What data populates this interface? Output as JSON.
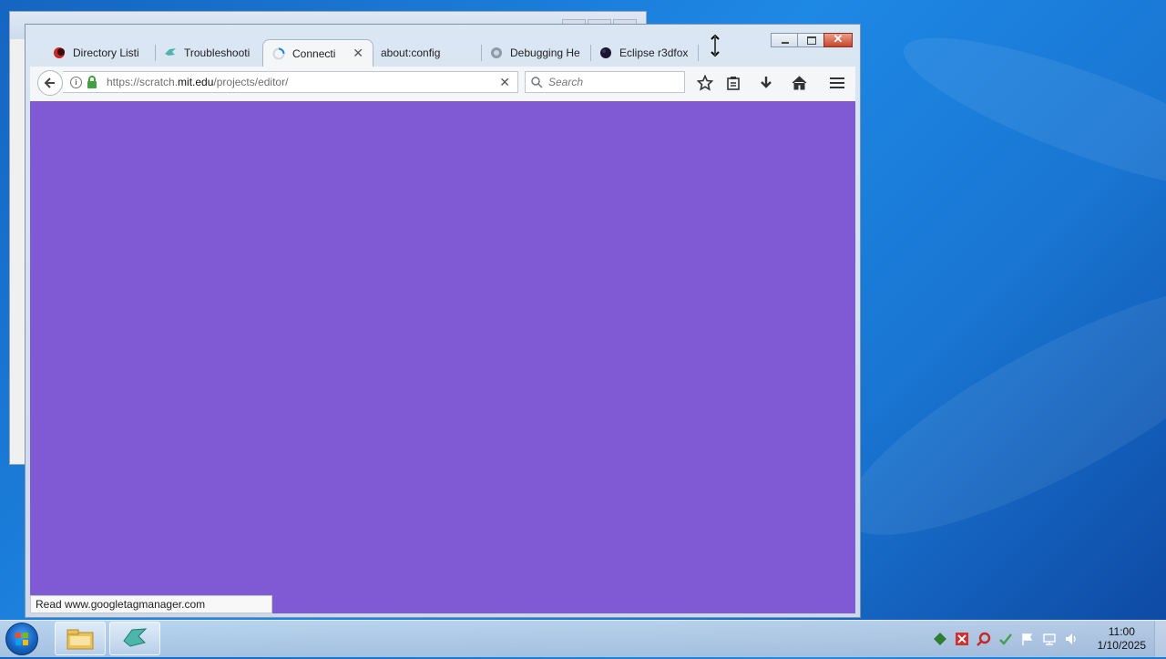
{
  "browser": {
    "tabs": [
      {
        "label": "Directory Listi",
        "icon": "eclipse-red-icon",
        "active": false
      },
      {
        "label": "Troubleshooti",
        "icon": "bird-icon",
        "active": false
      },
      {
        "label": "Connecti",
        "icon": "loading-spinner-icon",
        "active": true
      },
      {
        "label": "about:config",
        "icon": "",
        "active": false
      },
      {
        "label": "Debugging He",
        "icon": "puzzle-icon",
        "active": false
      },
      {
        "label": "Eclipse r3dfox",
        "icon": "dark-orb-icon",
        "active": false
      }
    ],
    "url": {
      "prefix": "https://scratch.",
      "domain": "mit.edu",
      "path": "/projects/editor/"
    },
    "search_placeholder": "Search",
    "status_text": "Read www.googletagmanager.com",
    "content_color": "#805ad5"
  },
  "taskbar": {
    "clock_time": "11:00",
    "clock_date": "1/10/2025",
    "pinned": [
      "file-explorer-icon",
      "r3dfox-bird-icon"
    ]
  }
}
